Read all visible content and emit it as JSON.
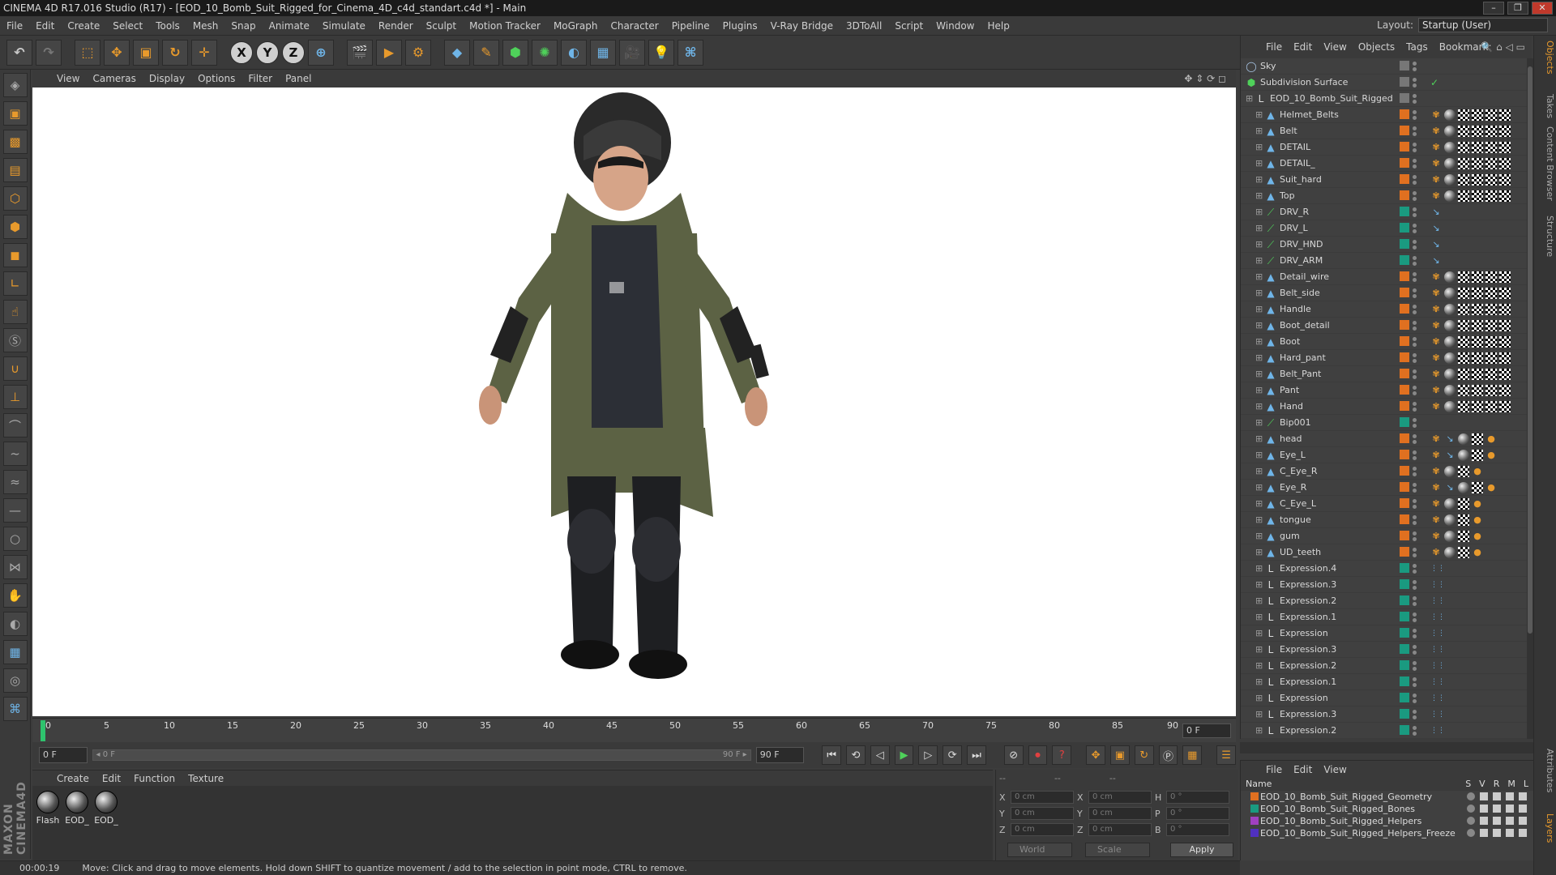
{
  "window": {
    "title": "CINEMA 4D R17.016 Studio (R17) - [EOD_10_Bomb_Suit_Rigged_for_Cinema_4D_c4d_standart.c4d *] - Main",
    "buttons": [
      "–",
      "❐",
      "✕"
    ]
  },
  "menubar": {
    "items": [
      "File",
      "Edit",
      "Create",
      "Select",
      "Tools",
      "Mesh",
      "Snap",
      "Animate",
      "Simulate",
      "Render",
      "Sculpt",
      "Motion Tracker",
      "MoGraph",
      "Character",
      "Pipeline",
      "Plugins",
      "V-Ray Bridge",
      "3DToAll",
      "Script",
      "Window",
      "Help"
    ],
    "layout_label": "Layout:",
    "layout_value": "Startup (User)"
  },
  "toolbar": {
    "icons": [
      "undo-icon",
      "redo-icon",
      "live-selection-icon",
      "move-icon",
      "scale-icon",
      "rotate-icon",
      "transform-icon",
      "x-axis-icon",
      "y-axis-icon",
      "z-axis-icon",
      "world-coordinates-icon",
      "render-view-icon",
      "render-picture-viewer-icon",
      "edit-render-settings-icon",
      "cube-icon",
      "pen-icon",
      "subdivision-icon",
      "array-icon",
      "deformer-icon",
      "floor-icon",
      "camera-icon",
      "light-icon",
      "python-icon"
    ],
    "axis_x": "X",
    "axis_y": "Y",
    "axis_z": "Z"
  },
  "viewport": {
    "menu": [
      "View",
      "Cameras",
      "Display",
      "Options",
      "Filter",
      "Panel"
    ]
  },
  "timeline": {
    "ticks": [
      "0",
      "5",
      "10",
      "15",
      "20",
      "25",
      "30",
      "35",
      "40",
      "45",
      "50",
      "55",
      "60",
      "65",
      "70",
      "75",
      "80",
      "85",
      "90"
    ],
    "current_frame": "0 F",
    "start_field": "0 F",
    "slider_left": "◂ 0 F",
    "slider_right": "90 F ▸",
    "end_field": "90 F"
  },
  "material_manager": {
    "menu": [
      "Create",
      "Edit",
      "Function",
      "Texture"
    ],
    "materials": [
      "Flash",
      "EOD_",
      "EOD_"
    ]
  },
  "coordinates": {
    "header_left": "--",
    "header_mid": "--",
    "header_right": "--",
    "rows": [
      {
        "a": "X",
        "av": "0 cm",
        "b": "X",
        "bv": "0 cm",
        "c": "H",
        "cv": "0 °"
      },
      {
        "a": "Y",
        "av": "0 cm",
        "b": "Y",
        "bv": "0 cm",
        "c": "P",
        "cv": "0 °"
      },
      {
        "a": "Z",
        "av": "0 cm",
        "b": "Z",
        "bv": "0 cm",
        "c": "B",
        "cv": "0 °"
      }
    ],
    "mode": "World",
    "type": "Scale",
    "apply": "Apply"
  },
  "status": {
    "time": "00:00:19",
    "message": "Move: Click and drag to move elements. Hold down SHIFT to quantize movement / add to the selection in point mode, CTRL to remove."
  },
  "object_manager": {
    "menu": [
      "File",
      "Edit",
      "View",
      "Objects",
      "Tags",
      "Bookmark:"
    ],
    "rows": [
      {
        "name": "Sky",
        "indent": 0,
        "icon": "sky",
        "color": "",
        "tags": "none"
      },
      {
        "name": "Subdivision Surface",
        "indent": 0,
        "icon": "subdiv",
        "color": "",
        "tags": "check"
      },
      {
        "name": "EOD_10_Bomb_Suit_Rigged",
        "indent": 1,
        "icon": "null",
        "color": "",
        "tags": "none"
      },
      {
        "name": "Helmet_Belts",
        "indent": 2,
        "icon": "mesh",
        "color": "#e07020",
        "tags": "full"
      },
      {
        "name": "Belt",
        "indent": 2,
        "icon": "mesh",
        "color": "#e07020",
        "tags": "full"
      },
      {
        "name": "DETAIL",
        "indent": 2,
        "icon": "mesh",
        "color": "#e07020",
        "tags": "full"
      },
      {
        "name": "DETAIL_",
        "indent": 2,
        "icon": "mesh",
        "color": "#e07020",
        "tags": "full"
      },
      {
        "name": "Suit_hard",
        "indent": 2,
        "icon": "mesh",
        "color": "#e07020",
        "tags": "full"
      },
      {
        "name": "Top",
        "indent": 2,
        "icon": "mesh",
        "color": "#e07020",
        "tags": "full"
      },
      {
        "name": "DRV_R",
        "indent": 2,
        "icon": "bone",
        "color": "#1a9a80",
        "tags": "ik"
      },
      {
        "name": "DRV_L",
        "indent": 2,
        "icon": "bone",
        "color": "#1a9a80",
        "tags": "ik"
      },
      {
        "name": "DRV_HND",
        "indent": 2,
        "icon": "bone",
        "color": "#1a9a80",
        "tags": "ik"
      },
      {
        "name": "DRV_ARM",
        "indent": 2,
        "icon": "bone",
        "color": "#1a9a80",
        "tags": "ik"
      },
      {
        "name": "Detail_wire",
        "indent": 2,
        "icon": "mesh",
        "color": "#e07020",
        "tags": "full"
      },
      {
        "name": "Belt_side",
        "indent": 2,
        "icon": "mesh",
        "color": "#e07020",
        "tags": "full"
      },
      {
        "name": "Handle",
        "indent": 2,
        "icon": "mesh",
        "color": "#e07020",
        "tags": "full"
      },
      {
        "name": "Boot_detail",
        "indent": 2,
        "icon": "mesh",
        "color": "#e07020",
        "tags": "full"
      },
      {
        "name": "Boot",
        "indent": 2,
        "icon": "mesh",
        "color": "#e07020",
        "tags": "full"
      },
      {
        "name": "Hard_pant",
        "indent": 2,
        "icon": "mesh",
        "color": "#e07020",
        "tags": "full"
      },
      {
        "name": "Belt_Pant",
        "indent": 2,
        "icon": "mesh",
        "color": "#e07020",
        "tags": "full"
      },
      {
        "name": "Pant",
        "indent": 2,
        "icon": "mesh",
        "color": "#e07020",
        "tags": "full"
      },
      {
        "name": "Hand",
        "indent": 2,
        "icon": "mesh",
        "color": "#e07020",
        "tags": "full"
      },
      {
        "name": "Bip001",
        "indent": 2,
        "icon": "bone",
        "color": "#1a9a80",
        "tags": "none"
      },
      {
        "name": "head",
        "indent": 2,
        "icon": "mesh",
        "color": "#e07020",
        "tags": "head"
      },
      {
        "name": "Eye_L",
        "indent": 2,
        "icon": "mesh",
        "color": "#e07020",
        "tags": "head"
      },
      {
        "name": "C_Eye_R",
        "indent": 2,
        "icon": "mesh",
        "color": "#e07020",
        "tags": "eye"
      },
      {
        "name": "Eye_R",
        "indent": 2,
        "icon": "mesh",
        "color": "#e07020",
        "tags": "head"
      },
      {
        "name": "C_Eye_L",
        "indent": 2,
        "icon": "mesh",
        "color": "#e07020",
        "tags": "eye"
      },
      {
        "name": "tongue",
        "indent": 2,
        "icon": "mesh",
        "color": "#e07020",
        "tags": "eye"
      },
      {
        "name": "gum",
        "indent": 2,
        "icon": "mesh",
        "color": "#e07020",
        "tags": "eye"
      },
      {
        "name": "UD_teeth",
        "indent": 2,
        "icon": "mesh",
        "color": "#e07020",
        "tags": "eye"
      },
      {
        "name": "Expression.4",
        "indent": 2,
        "icon": "null",
        "color": "#1a9a80",
        "tags": "xp"
      },
      {
        "name": "Expression.3",
        "indent": 2,
        "icon": "null",
        "color": "#1a9a80",
        "tags": "xp"
      },
      {
        "name": "Expression.2",
        "indent": 2,
        "icon": "null",
        "color": "#1a9a80",
        "tags": "xp"
      },
      {
        "name": "Expression.1",
        "indent": 2,
        "icon": "null",
        "color": "#1a9a80",
        "tags": "xp"
      },
      {
        "name": "Expression",
        "indent": 2,
        "icon": "null",
        "color": "#1a9a80",
        "tags": "xp"
      },
      {
        "name": "Expression.3",
        "indent": 2,
        "icon": "null",
        "color": "#1a9a80",
        "tags": "xp"
      },
      {
        "name": "Expression.2",
        "indent": 2,
        "icon": "null",
        "color": "#1a9a80",
        "tags": "xp"
      },
      {
        "name": "Expression.1",
        "indent": 2,
        "icon": "null",
        "color": "#1a9a80",
        "tags": "xp"
      },
      {
        "name": "Expression",
        "indent": 2,
        "icon": "null",
        "color": "#1a9a80",
        "tags": "xp"
      },
      {
        "name": "Expression.3",
        "indent": 2,
        "icon": "null",
        "color": "#1a9a80",
        "tags": "xp"
      },
      {
        "name": "Expression.2",
        "indent": 2,
        "icon": "null",
        "color": "#1a9a80",
        "tags": "xp"
      }
    ]
  },
  "layer_manager": {
    "menu": [
      "File",
      "Edit",
      "View"
    ],
    "name_header": "Name",
    "cols": [
      "S",
      "V",
      "R",
      "M",
      "L"
    ],
    "layers": [
      {
        "name": "EOD_10_Bomb_Suit_Rigged_Geometry",
        "color": "#e07020"
      },
      {
        "name": "EOD_10_Bomb_Suit_Rigged_Bones",
        "color": "#1a9a80"
      },
      {
        "name": "EOD_10_Bomb_Suit_Rigged_Helpers",
        "color": "#a040c0"
      },
      {
        "name": "EOD_10_Bomb_Suit_Rigged_Helpers_Freeze",
        "color": "#5030c0"
      }
    ]
  },
  "right_tabs": [
    "Objects",
    "Takes",
    "Content Browser",
    "Structure",
    "Attributes",
    "Layers"
  ]
}
